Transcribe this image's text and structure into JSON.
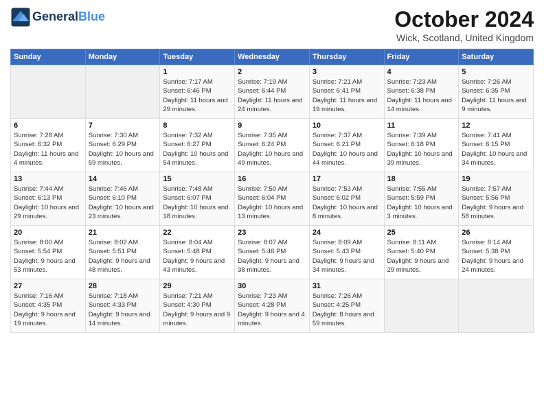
{
  "header": {
    "logo_line1": "General",
    "logo_line2": "Blue",
    "month": "October 2024",
    "location": "Wick, Scotland, United Kingdom"
  },
  "weekdays": [
    "Sunday",
    "Monday",
    "Tuesday",
    "Wednesday",
    "Thursday",
    "Friday",
    "Saturday"
  ],
  "weeks": [
    [
      {
        "day": "",
        "empty": true
      },
      {
        "day": "",
        "empty": true
      },
      {
        "day": "1",
        "sunrise": "7:17 AM",
        "sunset": "6:46 PM",
        "daylight": "11 hours and 29 minutes."
      },
      {
        "day": "2",
        "sunrise": "7:19 AM",
        "sunset": "6:44 PM",
        "daylight": "11 hours and 24 minutes."
      },
      {
        "day": "3",
        "sunrise": "7:21 AM",
        "sunset": "6:41 PM",
        "daylight": "11 hours and 19 minutes."
      },
      {
        "day": "4",
        "sunrise": "7:23 AM",
        "sunset": "6:38 PM",
        "daylight": "11 hours and 14 minutes."
      },
      {
        "day": "5",
        "sunrise": "7:26 AM",
        "sunset": "6:35 PM",
        "daylight": "11 hours and 9 minutes."
      }
    ],
    [
      {
        "day": "6",
        "sunrise": "7:28 AM",
        "sunset": "6:32 PM",
        "daylight": "11 hours and 4 minutes."
      },
      {
        "day": "7",
        "sunrise": "7:30 AM",
        "sunset": "6:29 PM",
        "daylight": "10 hours and 59 minutes."
      },
      {
        "day": "8",
        "sunrise": "7:32 AM",
        "sunset": "6:27 PM",
        "daylight": "10 hours and 54 minutes."
      },
      {
        "day": "9",
        "sunrise": "7:35 AM",
        "sunset": "6:24 PM",
        "daylight": "10 hours and 49 minutes."
      },
      {
        "day": "10",
        "sunrise": "7:37 AM",
        "sunset": "6:21 PM",
        "daylight": "10 hours and 44 minutes."
      },
      {
        "day": "11",
        "sunrise": "7:39 AM",
        "sunset": "6:18 PM",
        "daylight": "10 hours and 39 minutes."
      },
      {
        "day": "12",
        "sunrise": "7:41 AM",
        "sunset": "6:15 PM",
        "daylight": "10 hours and 34 minutes."
      }
    ],
    [
      {
        "day": "13",
        "sunrise": "7:44 AM",
        "sunset": "6:13 PM",
        "daylight": "10 hours and 29 minutes."
      },
      {
        "day": "14",
        "sunrise": "7:46 AM",
        "sunset": "6:10 PM",
        "daylight": "10 hours and 23 minutes."
      },
      {
        "day": "15",
        "sunrise": "7:48 AM",
        "sunset": "6:07 PM",
        "daylight": "10 hours and 18 minutes."
      },
      {
        "day": "16",
        "sunrise": "7:50 AM",
        "sunset": "6:04 PM",
        "daylight": "10 hours and 13 minutes."
      },
      {
        "day": "17",
        "sunrise": "7:53 AM",
        "sunset": "6:02 PM",
        "daylight": "10 hours and 8 minutes."
      },
      {
        "day": "18",
        "sunrise": "7:55 AM",
        "sunset": "5:59 PM",
        "daylight": "10 hours and 3 minutes."
      },
      {
        "day": "19",
        "sunrise": "7:57 AM",
        "sunset": "5:56 PM",
        "daylight": "9 hours and 58 minutes."
      }
    ],
    [
      {
        "day": "20",
        "sunrise": "8:00 AM",
        "sunset": "5:54 PM",
        "daylight": "9 hours and 53 minutes."
      },
      {
        "day": "21",
        "sunrise": "8:02 AM",
        "sunset": "5:51 PM",
        "daylight": "9 hours and 48 minutes."
      },
      {
        "day": "22",
        "sunrise": "8:04 AM",
        "sunset": "5:48 PM",
        "daylight": "9 hours and 43 minutes."
      },
      {
        "day": "23",
        "sunrise": "8:07 AM",
        "sunset": "5:46 PM",
        "daylight": "9 hours and 38 minutes."
      },
      {
        "day": "24",
        "sunrise": "8:09 AM",
        "sunset": "5:43 PM",
        "daylight": "9 hours and 34 minutes."
      },
      {
        "day": "25",
        "sunrise": "8:11 AM",
        "sunset": "5:40 PM",
        "daylight": "9 hours and 29 minutes."
      },
      {
        "day": "26",
        "sunrise": "8:14 AM",
        "sunset": "5:38 PM",
        "daylight": "9 hours and 24 minutes."
      }
    ],
    [
      {
        "day": "27",
        "sunrise": "7:16 AM",
        "sunset": "4:35 PM",
        "daylight": "9 hours and 19 minutes."
      },
      {
        "day": "28",
        "sunrise": "7:18 AM",
        "sunset": "4:33 PM",
        "daylight": "9 hours and 14 minutes."
      },
      {
        "day": "29",
        "sunrise": "7:21 AM",
        "sunset": "4:30 PM",
        "daylight": "9 hours and 9 minutes."
      },
      {
        "day": "30",
        "sunrise": "7:23 AM",
        "sunset": "4:28 PM",
        "daylight": "9 hours and 4 minutes."
      },
      {
        "day": "31",
        "sunrise": "7:26 AM",
        "sunset": "4:25 PM",
        "daylight": "8 hours and 59 minutes."
      },
      {
        "day": "",
        "empty": true
      },
      {
        "day": "",
        "empty": true
      }
    ]
  ]
}
